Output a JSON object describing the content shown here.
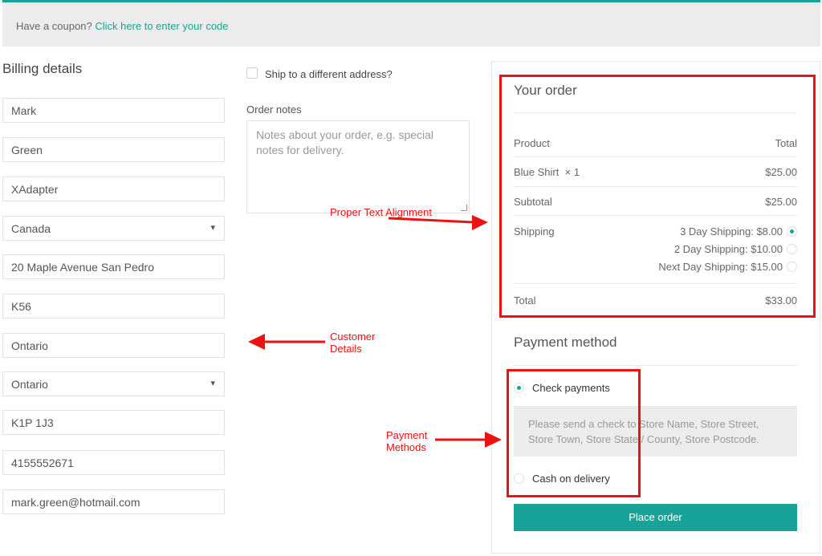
{
  "coupon": {
    "prompt": "Have a coupon?",
    "link": "Click here to enter your code"
  },
  "billing": {
    "title": "Billing details",
    "fields": [
      "Mark",
      "Green",
      "XAdapter",
      "Canada",
      "20 Maple Avenue San Pedro",
      "K56",
      "Ontario",
      "Ontario",
      "K1P 1J3",
      "4155552671",
      "mark.green@hotmail.com"
    ]
  },
  "shipping": {
    "different_address_label": "Ship to a different address?",
    "checked": false
  },
  "notes": {
    "label": "Order notes",
    "placeholder": "Notes about your order, e.g. special notes for delivery."
  },
  "order": {
    "title": "Your order",
    "header_product": "Product",
    "header_total": "Total",
    "item_name": "Blue Shirt",
    "item_qty": "× 1",
    "item_total": "$25.00",
    "subtotal_label": "Subtotal",
    "subtotal_value": "$25.00",
    "shipping_label": "Shipping",
    "shipping_options": [
      "3 Day Shipping: $8.00",
      "2 Day Shipping: $10.00",
      "Next Day Shipping: $15.00"
    ],
    "selected_shipping": "3 Day Shipping: $8.00",
    "total_label": "Total",
    "total_value": "$33.00"
  },
  "payment": {
    "title": "Payment method",
    "methods": [
      "Check payments",
      "Cash on delivery"
    ],
    "selected": "Check payments",
    "check_description": "Please send a check to Store Name, Store Street, Store Town, Store State / County, Store Postcode.",
    "place_order": "Place order"
  },
  "annotations": {
    "text_alignment": "Proper Text Alignment",
    "customer_details": "Customer Details",
    "payment_methods": "Payment Methods",
    "color": "#ee1111"
  },
  "colors": {
    "accent": "#17a398",
    "annotation": "#ee1111"
  }
}
